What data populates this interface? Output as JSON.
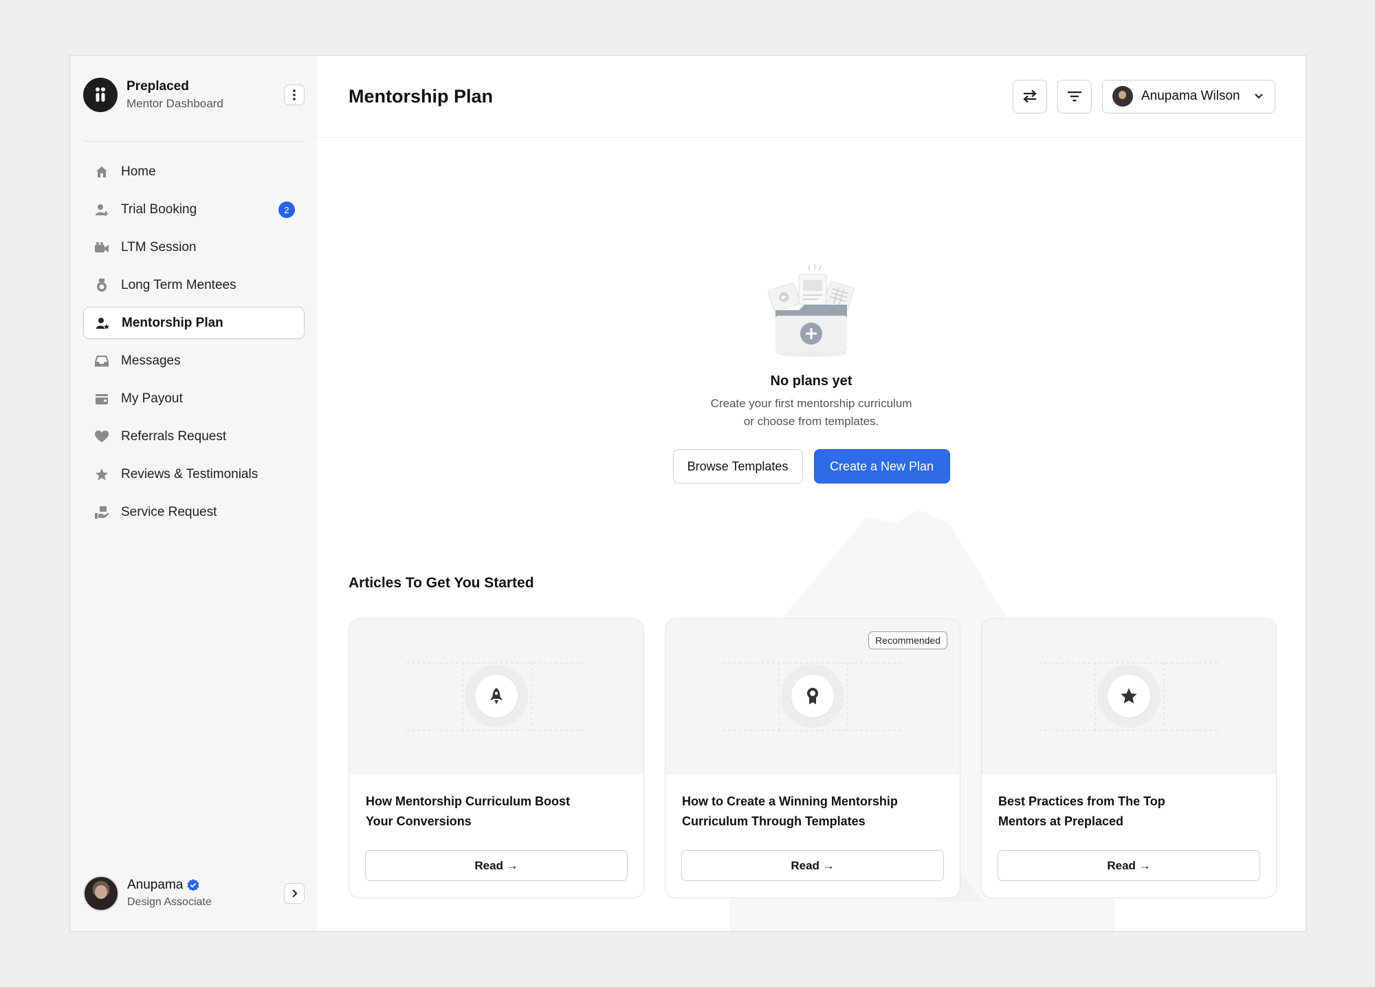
{
  "brand": {
    "name": "Preplaced",
    "subtitle": "Mentor Dashboard"
  },
  "sidebar": {
    "items": [
      {
        "label": "Home",
        "icon": "home-icon"
      },
      {
        "label": "Trial Booking",
        "icon": "user-plus-icon",
        "badge": "2"
      },
      {
        "label": "LTM Session",
        "icon": "video-icon"
      },
      {
        "label": "Long Term Mentees",
        "icon": "medal-icon"
      },
      {
        "label": "Mentorship Plan",
        "icon": "user-star-icon",
        "active": true
      },
      {
        "label": "Messages",
        "icon": "inbox-icon"
      },
      {
        "label": "My Payout",
        "icon": "wallet-icon"
      },
      {
        "label": "Referrals Request",
        "icon": "heart-icon"
      },
      {
        "label": "Reviews & Testimonials",
        "icon": "star-icon"
      },
      {
        "label": "Service Request",
        "icon": "hand-box-icon"
      }
    ]
  },
  "user": {
    "name": "Anupama",
    "role": "Design Associate"
  },
  "header": {
    "title": "Mentorship Plan",
    "user_name": "Anupama Wilson"
  },
  "empty_state": {
    "title": "No plans yet",
    "desc_line1": "Create your first mentorship curriculum",
    "desc_line2": "or choose from templates.",
    "browse_label": "Browse Templates",
    "create_label": "Create a New Plan"
  },
  "articles": {
    "title": "Articles To Get You Started",
    "cards": [
      {
        "title_line1": "How Mentorship Curriculum Boost",
        "title_line2": "Your Conversions",
        "icon": "rocket-icon",
        "read_label": "Read →"
      },
      {
        "title_line1": "How to Create a Winning Mentorship",
        "title_line2": "Curriculum Through Templates",
        "icon": "award-icon",
        "badge": "Recommended",
        "read_label": "Read →"
      },
      {
        "title_line1": "Best Practices from The Top",
        "title_line2": "Mentors at Preplaced",
        "icon": "star-icon",
        "read_label": "Read →"
      }
    ]
  },
  "colors": {
    "accent": "#2e6be6",
    "badge": "#2563eb",
    "sidebar_bg": "#f6f6f6"
  }
}
